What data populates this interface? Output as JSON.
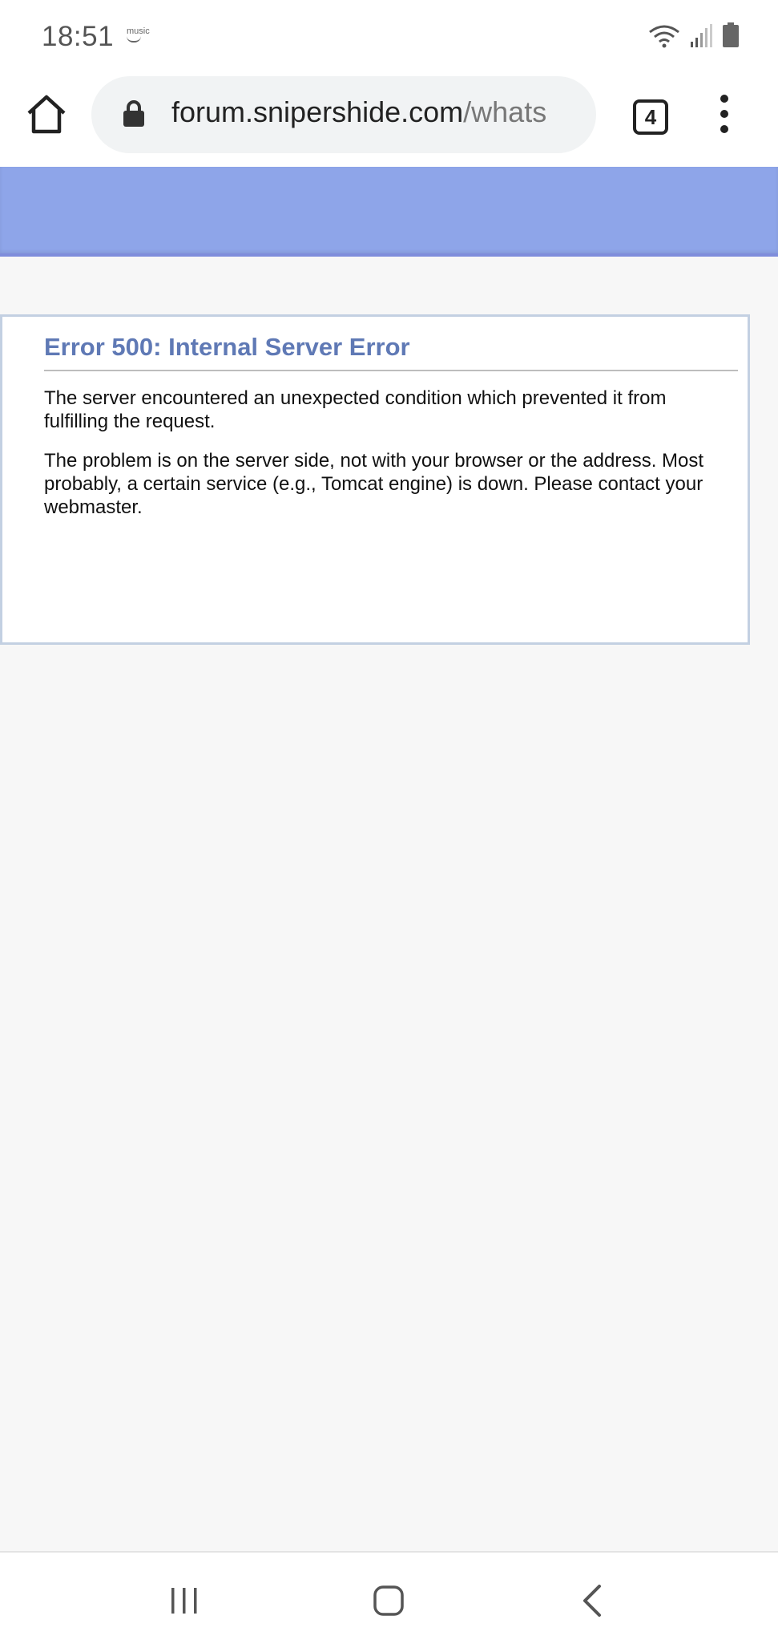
{
  "status_bar": {
    "time": "18:51",
    "music_label": "music",
    "battery_color": "#666666"
  },
  "browser": {
    "url_host": "forum.snipershide.com",
    "url_path": "/whats",
    "tab_count": "4"
  },
  "banner": {
    "color": "#8ea5e9"
  },
  "error": {
    "title": "Error 500: Internal Server Error",
    "paragraph1": "The server encountered an unexpected condition which prevented it from fulfilling the request.",
    "paragraph2": "The problem is on the server side, not with your browser or the address. Most probably, a certain service (e.g., Tomcat engine) is down. Please contact your webmaster."
  },
  "nav_bar": {
    "icons": [
      "recent-apps-icon",
      "home-icon",
      "back-icon"
    ]
  }
}
